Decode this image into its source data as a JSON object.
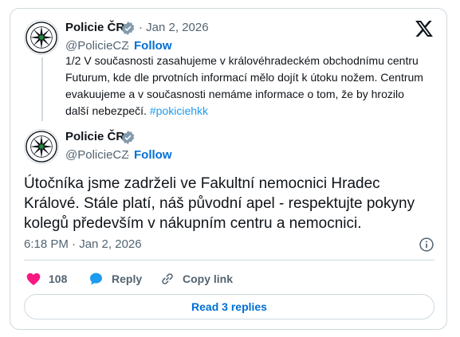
{
  "colors": {
    "accent": "#1d9bf0",
    "link": "#006fd6",
    "like": "#f91880",
    "muted": "#536471",
    "text": "#0f1419"
  },
  "quoted_tweet": {
    "author_name": "Policie ČR",
    "date": "· Jan 2, 2026",
    "handle": "@PolicieCZ",
    "follow_separator": "·",
    "follow_label": "Follow",
    "text": "1/2 V současnosti zasahujeme v královéhradeckém obchodnímu centru Futurum, kde dle prvotních informací mělo dojít k útoku nožem. Centrum evakuujeme a v současnosti nemáme informace o tom, že by hrozilo další nebezpečí. ",
    "hashtag": "#pokiciehkk"
  },
  "main_tweet": {
    "author_name": "Policie ČR",
    "handle": "@PolicieCZ",
    "follow_separator": "·",
    "follow_label": "Follow",
    "text": "Útočníka jsme zadrželi ve Fakultní nemocnici Hradec Králové. Stále platí, náš původní apel - respektujte pokyny kolegů především v nákupním centru a nemocnici.",
    "timestamp": "6:18 PM · Jan 2, 2026"
  },
  "actions": {
    "like_count": "108",
    "reply_label": "Reply",
    "copy_label": "Copy link"
  },
  "read_replies_label": "Read 3 replies",
  "icons": [
    "x-logo-icon",
    "verified-badge-icon",
    "heart-icon",
    "reply-bubble-icon",
    "link-icon",
    "info-icon",
    "police-star-icon"
  ]
}
